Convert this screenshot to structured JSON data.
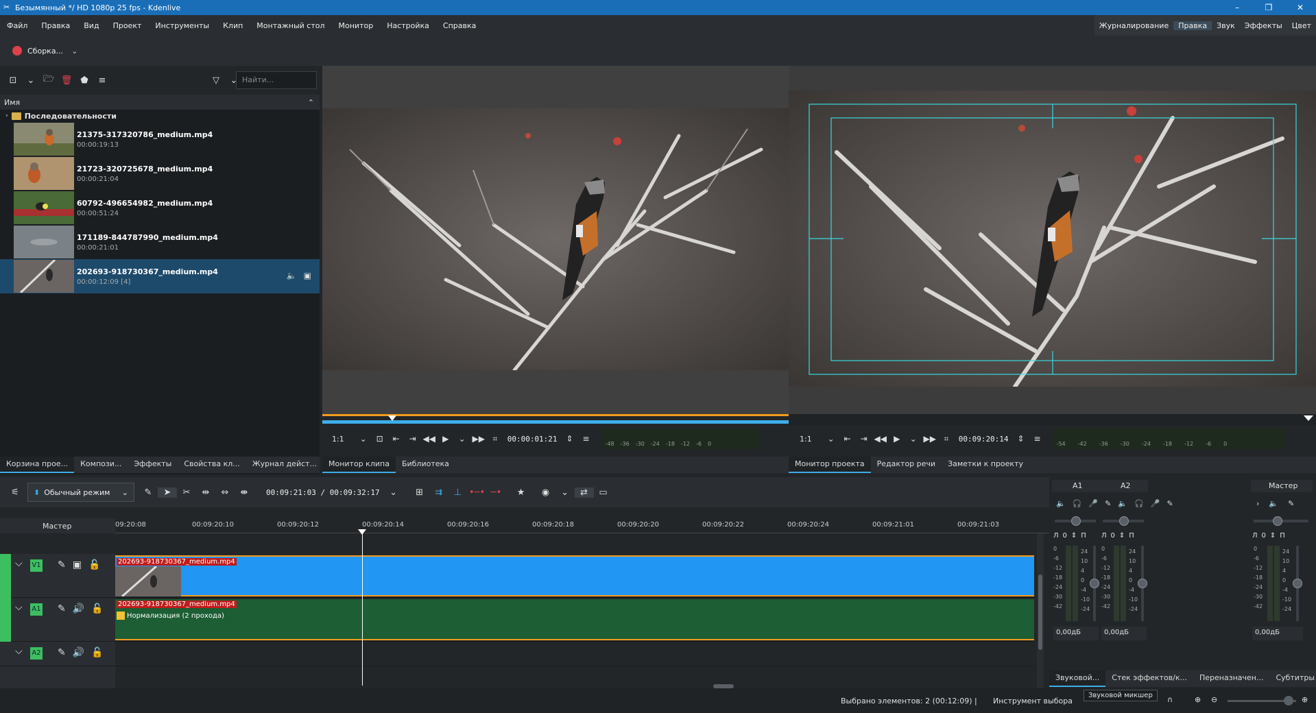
{
  "window": {
    "title": "Безымянный */ HD 1080p 25 fps - Kdenlive"
  },
  "menu": [
    "Файл",
    "Правка",
    "Вид",
    "Проект",
    "Инструменты",
    "Клип",
    "Монтажный стол",
    "Монитор",
    "Настройка",
    "Справка"
  ],
  "workspaces": [
    "Журналирование",
    "Правка",
    "Звук",
    "Эффекты",
    "Цвет"
  ],
  "toolbar": {
    "render_label": "Сборка..."
  },
  "bin": {
    "search_placeholder": "Найти...",
    "column_header": "Имя",
    "folder": "Последовательности",
    "clips": [
      {
        "name": "21375-317320786_medium.mp4",
        "duration": "00:00:19:13"
      },
      {
        "name": "21723-320725678_medium.mp4",
        "duration": "00:00:21:04"
      },
      {
        "name": "60792-496654982_medium.mp4",
        "duration": "00:00:51:24"
      },
      {
        "name": "171189-844787990_medium.mp4",
        "duration": "00:00:21:01"
      },
      {
        "name": "202693-918730367_medium.mp4",
        "duration": "00:00:12:09 [4]"
      }
    ]
  },
  "left_tabs": [
    "Корзина прое...",
    "Компози...",
    "Эффекты",
    "Свойства кл...",
    "Журнал дейст..."
  ],
  "clip_monitor": {
    "zoom": "1:1",
    "timecode": "00:00:01:21",
    "tabs": [
      "Монитор клипа",
      "Библиотека"
    ],
    "vu_scale": [
      "-48",
      "-36",
      "-30",
      "-24",
      "-18",
      "-12",
      "-6",
      "0"
    ]
  },
  "project_monitor": {
    "zoom": "1:1",
    "timecode": "00:09:20:14",
    "tabs": [
      "Монитор проекта",
      "Редактор речи",
      "Заметки к проекту"
    ],
    "vu_scale": [
      "-54",
      "-42",
      "-36",
      "-30",
      "-24",
      "-18",
      "-12",
      "-6",
      "0"
    ]
  },
  "timeline": {
    "mode": "Обычный режим",
    "position": "00:09:21:03 / 00:09:32:17",
    "master_label": "Мастер",
    "ruler": [
      "09:20:08",
      "00:09:20:10",
      "00:09:20:12",
      "00:09:20:14",
      "00:09:20:16",
      "00:09:20:18",
      "00:09:20:20",
      "00:09:20:22",
      "00:09:20:24",
      "00:09:21:01",
      "00:09:21:03"
    ],
    "tracks": [
      {
        "tag": "V1",
        "clip": "202693-918730367_medium.mp4"
      },
      {
        "tag": "A1",
        "clip": "202693-918730367_medium.mp4",
        "effect": "Нормализация (2 прохода)"
      },
      {
        "tag": "A2"
      }
    ]
  },
  "mixer": {
    "channels": [
      "A1",
      "A2"
    ],
    "master": "Мастер",
    "left": "Л",
    "right": "П",
    "zero": "0",
    "level": "0,00дБ",
    "scale_left": [
      "0",
      "-6",
      "-12",
      "-18",
      "-24",
      "-30",
      "-42"
    ],
    "scale_right": [
      "24",
      "10",
      "4",
      "0",
      "-4",
      "-10",
      "-24"
    ],
    "tabs": [
      "Звуковой...",
      "Стек эффектов/к...",
      "Переназначен...",
      "Субтитры"
    ],
    "tooltip": "Звуковой микшер"
  },
  "status": {
    "selection": "Выбрано элементов: 2 (00:12:09) |",
    "tool": "Инструмент выбора"
  },
  "colors": {
    "accent": "#3daee9",
    "titlebar": "#1a6eb8",
    "video_clip": "#2196f3",
    "audio_clip": "#1d5e34",
    "track_tag": "#3cbf60"
  }
}
